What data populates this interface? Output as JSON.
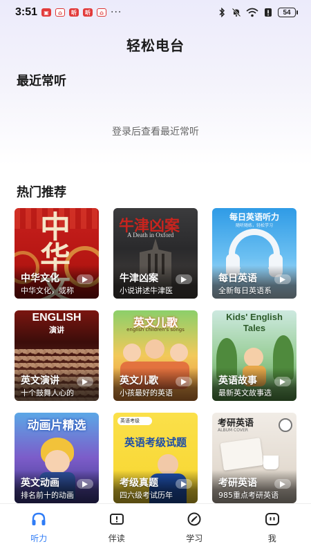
{
  "status_bar": {
    "time": "3:51",
    "battery": "54",
    "dots": "···"
  },
  "page": {
    "title": "轻松电台"
  },
  "recent": {
    "title": "最近常听",
    "empty_text": "登录后查看最近常听"
  },
  "hot": {
    "title": "热门推荐",
    "cards": [
      {
        "name": "中华文化",
        "desc": "中华文化，或称",
        "art": "中华文"
      },
      {
        "name": "牛津凶案",
        "desc": "小说讲述牛津医",
        "art": "牛津凶案",
        "art_sub": "A Death in Oxford"
      },
      {
        "name": "每日英语",
        "desc": "全新每日英语系",
        "art": "每日英语听力",
        "art_sub": "随听随练，轻松学习"
      },
      {
        "name": "英文演讲",
        "desc": "十个鼓舞人心的",
        "art": "ENGLISH",
        "art_sub": "演讲"
      },
      {
        "name": "英文儿歌",
        "desc": "小孩最好的英语",
        "art": "英文儿歌",
        "art_sub": "english children's songs"
      },
      {
        "name": "英语故事",
        "desc": "最新英文故事选",
        "art": "Kids' English Tales"
      },
      {
        "name": "英文动画",
        "desc": "排名前十的动画",
        "art": "动画片精选"
      },
      {
        "name": "考级真题",
        "desc": "四六级考试历年",
        "art": "英语考级试题",
        "art_sub": "英语考级"
      },
      {
        "name": "考研英语",
        "desc": "985重点考研英语",
        "art": "考研英语",
        "art_sub": "ALBUM COVER"
      }
    ]
  },
  "tabs": [
    {
      "label": "听力",
      "icon": "headphones-icon",
      "active": true
    },
    {
      "label": "伴读",
      "icon": "reader-icon",
      "active": false
    },
    {
      "label": "学习",
      "icon": "compass-icon",
      "active": false
    },
    {
      "label": "我",
      "icon": "profile-icon",
      "active": false
    }
  ],
  "colors": {
    "accent": "#2f7cf6"
  }
}
